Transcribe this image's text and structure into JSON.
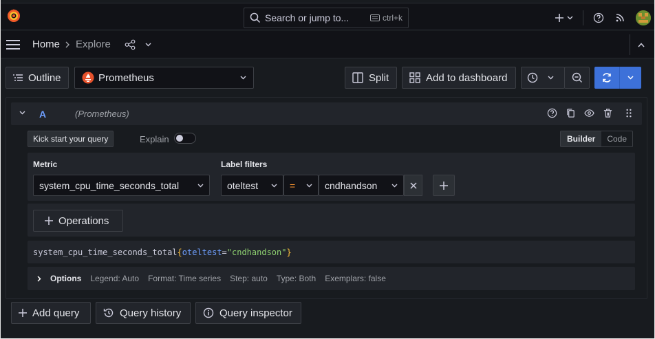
{
  "search": {
    "placeholder": "Search or jump to...",
    "shortcut": "ctrl+k"
  },
  "breadcrumb": {
    "home": "Home",
    "current": "Explore"
  },
  "toolbar": {
    "outline": "Outline",
    "datasource": "Prometheus",
    "split": "Split",
    "add_to_dashboard": "Add to dashboard"
  },
  "query": {
    "ref_id": "A",
    "datasource": "(Prometheus)",
    "kick_start": "Kick start your query",
    "explain": "Explain",
    "mode_builder": "Builder",
    "mode_code": "Code",
    "metric_label": "Metric",
    "metric_value": "system_cpu_time_seconds_total",
    "label_filters_label": "Label filters",
    "filter_label": "oteltest",
    "filter_op": "=",
    "filter_value": "cndhandson",
    "operations": "Operations",
    "preview": {
      "metric": "system_cpu_time_seconds_total",
      "open": "{",
      "key": "oteltest",
      "eq": "=",
      "val": "\"cndhandson\"",
      "close": "}"
    },
    "options": {
      "title": "Options",
      "legend": "Legend: Auto",
      "format": "Format: Time series",
      "step": "Step: auto",
      "type": "Type: Both",
      "exemplars": "Exemplars: false"
    }
  },
  "footer": {
    "add_query": "Add query",
    "query_history": "Query history",
    "query_inspector": "Query inspector"
  },
  "colors": {
    "accent": "#3d71d9",
    "brand": "#f05a28",
    "ref": "#6e9fff",
    "operator": "#ff9830"
  }
}
